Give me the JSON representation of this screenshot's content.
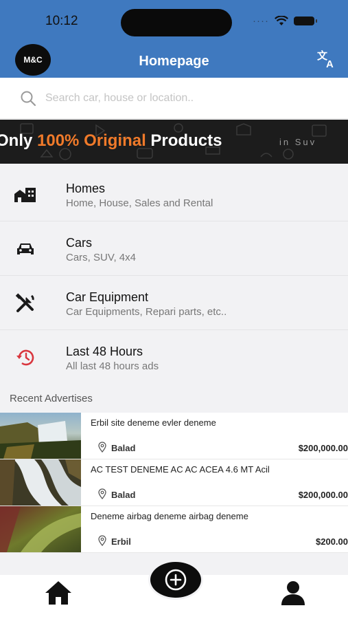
{
  "status_bar": {
    "time": "10:12",
    "signal": "····"
  },
  "header": {
    "logo_text": "M&C",
    "title": "Homepage"
  },
  "search": {
    "placeholder": "Search car, house or location.."
  },
  "banner": {
    "prefix": "Only ",
    "accent": "100% Original",
    "suffix": " Products",
    "tail": "in Suv"
  },
  "categories": [
    {
      "title": "Homes",
      "subtitle": "Home, House, Sales and Rental",
      "icon": "homes-icon"
    },
    {
      "title": "Cars",
      "subtitle": "Cars, SUV, 4x4",
      "icon": "car-icon"
    },
    {
      "title": "Car Equipment",
      "subtitle": "Car Equipments, Repari parts, etc..",
      "icon": "tools-icon"
    },
    {
      "title": "Last 48 Hours",
      "subtitle": "All last 48 hours ads",
      "icon": "history-icon"
    }
  ],
  "recent": {
    "label": "Recent Advertises",
    "ads": [
      {
        "title": "Erbil site deneme evler deneme",
        "location": "Balad",
        "price": "$200,000.00"
      },
      {
        "title": "AC TEST DENEME AC AC ACEA 4.6 MT Acil",
        "location": "Balad",
        "price": "$200,000.00"
      },
      {
        "title": "Deneme airbag deneme airbag deneme",
        "location": "Erbil",
        "price": "$200.00"
      }
    ]
  },
  "bottom_nav": {
    "items": [
      "home-icon",
      "add-button",
      "profile-icon"
    ]
  },
  "colors": {
    "header_blue": "#3f79bf",
    "accent_orange": "#f07a2a",
    "history_red": "#d9363e"
  }
}
